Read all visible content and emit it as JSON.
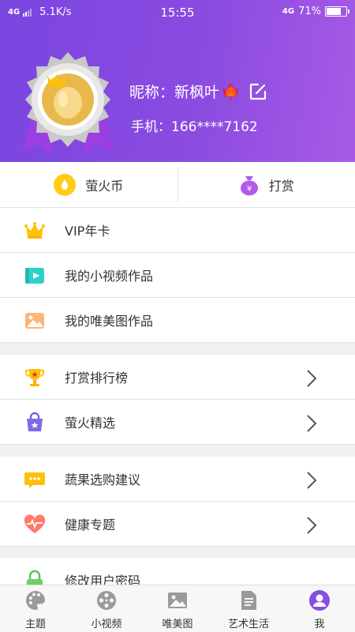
{
  "status_bar": {
    "network_left": "4G",
    "speed": "5.1K/s",
    "time": "15:55",
    "network_right": "4G",
    "battery": "71%"
  },
  "profile": {
    "nickname_label": "昵称：",
    "nickname_value": "新枫叶",
    "leaf_emoji": "🍁",
    "phone_label": "手机：",
    "phone_value": "166****7162"
  },
  "actions": [
    {
      "label": "萤火币",
      "icon": "coin-icon"
    },
    {
      "label": "打赏",
      "icon": "money-bag-icon"
    }
  ],
  "menu_group_1": [
    {
      "label": "VIP年卡",
      "icon": "crown-icon"
    },
    {
      "label": "我的小视频作品",
      "icon": "video-icon"
    },
    {
      "label": "我的唯美图作品",
      "icon": "image-icon"
    }
  ],
  "menu_group_2": [
    {
      "label": "打赏排行榜",
      "icon": "trophy-icon"
    },
    {
      "label": "萤火精选",
      "icon": "shopping-bag-icon"
    }
  ],
  "menu_group_3": [
    {
      "label": "蔬果选购建议",
      "icon": "chat-icon"
    },
    {
      "label": "健康专题",
      "icon": "heart-icon"
    }
  ],
  "menu_group_4": [
    {
      "label": "修改用户密码",
      "icon": "lock-icon"
    }
  ],
  "bottom_nav": [
    {
      "label": "主题",
      "icon": "palette-icon"
    },
    {
      "label": "小视频",
      "icon": "film-icon"
    },
    {
      "label": "唯美图",
      "icon": "picture-icon"
    },
    {
      "label": "艺术生活",
      "icon": "document-icon"
    },
    {
      "label": "我",
      "icon": "user-icon",
      "active": true
    }
  ],
  "colors": {
    "header_start": "#7a45e0",
    "header_end": "#a85ae6",
    "accent_purple": "#8a4be0",
    "gold": "#ffc107"
  }
}
